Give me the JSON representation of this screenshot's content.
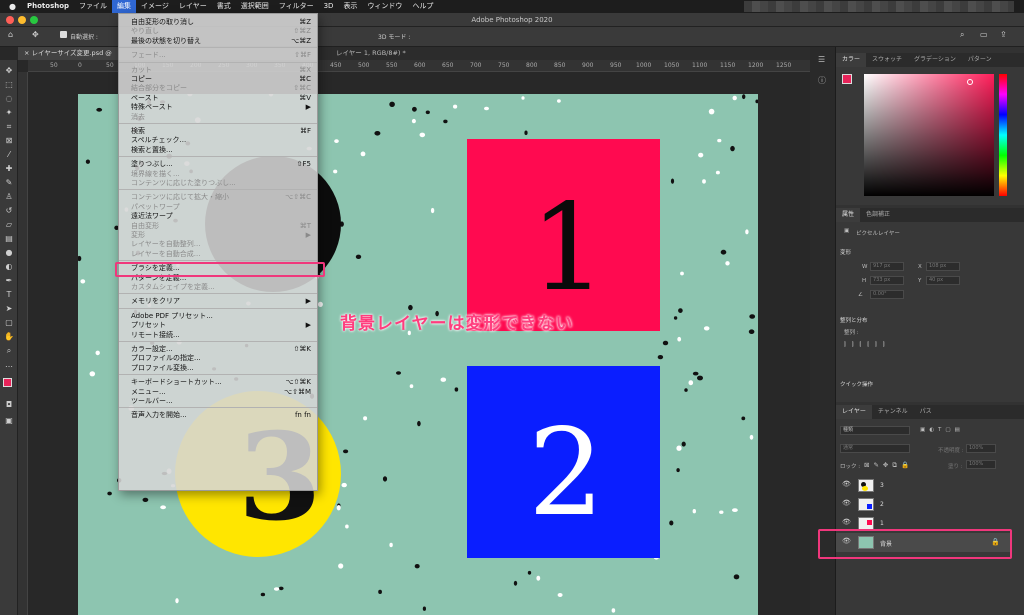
{
  "menubar": {
    "app": "Photoshop",
    "items": [
      "ファイル",
      "編集",
      "イメージ",
      "レイヤー",
      "書式",
      "選択範囲",
      "フィルター",
      "3D",
      "表示",
      "ウィンドウ",
      "ヘルプ"
    ]
  },
  "window": {
    "title": "Adobe Photoshop 2020"
  },
  "options": {
    "auto_select": "自動選択 :",
    "mode_3d": "3D モード :"
  },
  "document_tab": {
    "label": "レイヤーサイズ変更.psd @",
    "right_part": "レイヤー 1, RGB/8#) *"
  },
  "ruler_labels": [
    "50",
    "0",
    "50",
    "100",
    "150",
    "200",
    "250",
    "300",
    "350",
    "400",
    "450",
    "500",
    "550",
    "600",
    "650",
    "700",
    "750",
    "800",
    "850",
    "900",
    "950",
    "1000",
    "1050",
    "1100",
    "1150",
    "1200",
    "1250"
  ],
  "edit_menu": [
    {
      "label": "自由変形の取り消し",
      "shortcut": "⌘Z",
      "disabled": false
    },
    {
      "label": "やり直し",
      "shortcut": "⇧⌘Z",
      "disabled": true
    },
    {
      "label": "最後の状態を切り替え",
      "shortcut": "⌥⌘Z",
      "disabled": false
    },
    {
      "sep": true
    },
    {
      "label": "フェード...",
      "shortcut": "⇧⌘F",
      "disabled": true
    },
    {
      "sep": true
    },
    {
      "label": "カット",
      "shortcut": "⌘X",
      "disabled": true
    },
    {
      "label": "コピー",
      "shortcut": "⌘C",
      "disabled": false
    },
    {
      "label": "結合部分をコピー",
      "shortcut": "⇧⌘C",
      "disabled": true
    },
    {
      "label": "ペースト",
      "shortcut": "⌘V",
      "disabled": false
    },
    {
      "label": "特殊ペースト",
      "shortcut": "▶",
      "disabled": false
    },
    {
      "label": "消去",
      "shortcut": "",
      "disabled": true
    },
    {
      "sep": true
    },
    {
      "label": "検索",
      "shortcut": "⌘F",
      "disabled": false
    },
    {
      "label": "スペルチェック...",
      "shortcut": "",
      "disabled": false
    },
    {
      "label": "検索と置換...",
      "shortcut": "",
      "disabled": false
    },
    {
      "sep": true
    },
    {
      "label": "塗りつぶし...",
      "shortcut": "⇧F5",
      "disabled": false
    },
    {
      "label": "境界線を描く...",
      "shortcut": "",
      "disabled": true
    },
    {
      "label": "コンテンツに応じた塗りつぶし...",
      "shortcut": "",
      "disabled": true
    },
    {
      "sep": true
    },
    {
      "label": "コンテンツに応じて拡大・縮小",
      "shortcut": "⌥⇧⌘C",
      "disabled": true
    },
    {
      "label": "パペットワープ",
      "shortcut": "",
      "disabled": true
    },
    {
      "label": "遠近法ワープ",
      "shortcut": "",
      "disabled": false
    },
    {
      "label": "自由変形",
      "shortcut": "⌘T",
      "disabled": true
    },
    {
      "label": "変形",
      "shortcut": "▶",
      "disabled": true
    },
    {
      "label": "レイヤーを自動整列...",
      "shortcut": "",
      "disabled": true
    },
    {
      "label": "レイヤーを自動合成...",
      "shortcut": "",
      "disabled": true
    },
    {
      "sep": true
    },
    {
      "label": "ブラシを定義...",
      "shortcut": "",
      "disabled": false
    },
    {
      "label": "パターンを定義...",
      "shortcut": "",
      "disabled": false
    },
    {
      "label": "カスタムシェイプを定義...",
      "shortcut": "",
      "disabled": true
    },
    {
      "sep": true
    },
    {
      "label": "メモリをクリア",
      "shortcut": "▶",
      "disabled": false
    },
    {
      "sep": true
    },
    {
      "label": "Adobe PDF プリセット...",
      "shortcut": "",
      "disabled": false
    },
    {
      "label": "プリセット",
      "shortcut": "▶",
      "disabled": false
    },
    {
      "label": "リモート接続...",
      "shortcut": "",
      "disabled": false
    },
    {
      "sep": true
    },
    {
      "label": "カラー設定...",
      "shortcut": "⇧⌘K",
      "disabled": false
    },
    {
      "label": "プロファイルの指定...",
      "shortcut": "",
      "disabled": false
    },
    {
      "label": "プロファイル変換...",
      "shortcut": "",
      "disabled": false
    },
    {
      "sep": true
    },
    {
      "label": "キーボードショートカット...",
      "shortcut": "⌥⇧⌘K",
      "disabled": false
    },
    {
      "label": "メニュー...",
      "shortcut": "⌥⇧⌘M",
      "disabled": false
    },
    {
      "label": "ツールバー...",
      "shortcut": "",
      "disabled": false
    },
    {
      "sep": true
    },
    {
      "label": "音声入力を開始...",
      "shortcut": "fn fn",
      "disabled": false
    }
  ],
  "annotation": "背景レイヤーは変形できない",
  "canvas": {
    "bg": "#8dc5b0",
    "square1": {
      "label": "1",
      "color": "#ff0a50"
    },
    "square2": {
      "label": "2",
      "color": "#0a1eff"
    },
    "circle3": {
      "label": "3",
      "color": "#ffe600"
    }
  },
  "color_panel": {
    "tabs": [
      "カラー",
      "スウォッチ",
      "グラデーション",
      "パターン"
    ]
  },
  "props_panel": {
    "tabs": [
      "属性",
      "色調補正"
    ],
    "pixel_layer": "ピクセルレイヤー",
    "transform": "変形",
    "w_label": "W",
    "w_val": "917 px",
    "x_label": "X",
    "x_val": "108 px",
    "h_label": "H",
    "h_val": "733 px",
    "y_label": "Y",
    "y_val": "40 px",
    "angle_val": "0.00°",
    "align_title": "整列と分布",
    "align_sub": "整列 :",
    "quick": "クイック操作"
  },
  "layers_panel": {
    "tabs": [
      "レイヤー",
      "チャンネル",
      "パス"
    ],
    "kind": "種類",
    "blend": "通常",
    "opacity_label": "不透明度 :",
    "opacity_val": "100%",
    "lock_label": "ロック :",
    "fill_label": "塗り :",
    "fill_val": "100%",
    "layers": [
      {
        "name": "3"
      },
      {
        "name": "2"
      },
      {
        "name": "1"
      },
      {
        "name": "背景"
      }
    ]
  }
}
